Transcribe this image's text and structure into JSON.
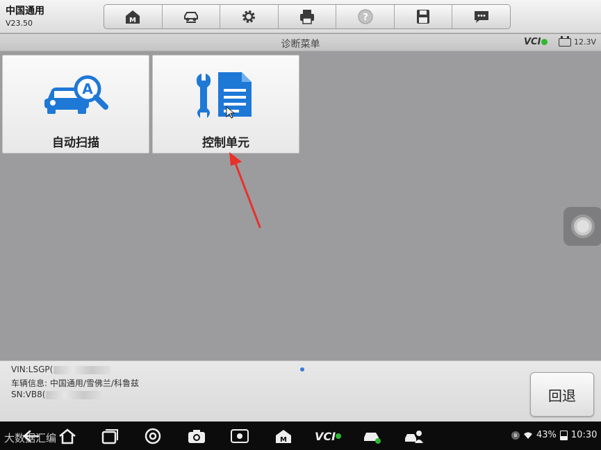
{
  "app": {
    "title": "中国通用",
    "version": "V23.50"
  },
  "toolbar": {
    "buttons": [
      {
        "icon": "home-m-icon"
      },
      {
        "icon": "vehicle-lift-icon"
      },
      {
        "icon": "gear-icon"
      },
      {
        "icon": "printer-icon"
      },
      {
        "icon": "help-icon",
        "disabled": true
      },
      {
        "icon": "save-icon"
      },
      {
        "icon": "message-icon"
      }
    ]
  },
  "strip": {
    "title": "诊断菜单",
    "vci_label": "VCI",
    "voltage": "12.3V"
  },
  "tiles": [
    {
      "label": "自动扫描",
      "icon": "car-auto-scan-icon"
    },
    {
      "label": "控制单元",
      "icon": "wrench-document-icon"
    }
  ],
  "info": {
    "vin": "VIN:LSGP(",
    "vehicle": "车辆信息: 中国通用/雪佛兰/科鲁兹",
    "sn": "SN:VB8("
  },
  "back_button": {
    "label": "回退"
  },
  "navbar": {
    "watermark": "大数据汇编",
    "battery_percent": "43%",
    "time": "10:30",
    "vci_label": "VCI"
  },
  "colors": {
    "accent_blue": "#1e78d6",
    "status_green": "#2eb82e",
    "annotation_red": "#e8312a"
  }
}
